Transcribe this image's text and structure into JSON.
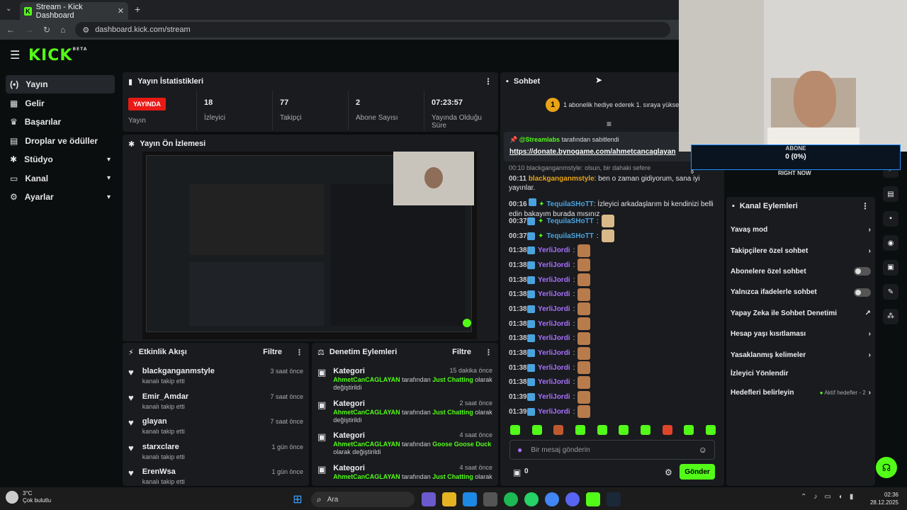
{
  "browser": {
    "tab_title": "Stream - Kick Dashboard",
    "url": "dashboard.kick.com/stream"
  },
  "logo": {
    "text": "KICK",
    "beta": "BETA"
  },
  "sidebar": {
    "items": [
      {
        "label": "Yayın",
        "icon": "broadcast-icon",
        "active": true
      },
      {
        "label": "Gelir",
        "icon": "revenue-icon"
      },
      {
        "label": "Başarılar",
        "icon": "trophy-icon"
      },
      {
        "label": "Droplar ve ödüller",
        "icon": "gift-icon"
      },
      {
        "label": "Stüdyo",
        "icon": "studio-icon",
        "expand": true
      },
      {
        "label": "Kanal",
        "icon": "channel-icon",
        "expand": true
      },
      {
        "label": "Ayarlar",
        "icon": "settings-icon",
        "expand": true
      }
    ]
  },
  "stats": {
    "title": "Yayın İstatistikleri",
    "live_badge": "YAYINDA",
    "live_label": "Yayın",
    "viewers": "18",
    "viewers_label": "İzleyici",
    "followers": "77",
    "followers_label": "Takipçi",
    "subs": "2",
    "subs_label": "Abone Sayısı",
    "uptime": "07:23:57",
    "uptime_label": "Yayında Olduğu Süre"
  },
  "preview": {
    "title": "Yayın Ön İzlemesi"
  },
  "activity": {
    "title": "Etkinlik Akışı",
    "filter": "Filtre",
    "items": [
      {
        "name": "blackganganmstyle",
        "sub": "kanalı takip etti",
        "time": "3 saat önce"
      },
      {
        "name": "Emir_Amdar",
        "sub": "kanalı takip etti",
        "time": "7 saat önce"
      },
      {
        "name": "glayan",
        "sub": "kanalı takip etti",
        "time": "7 saat önce"
      },
      {
        "name": "starxclare",
        "sub": "kanalı takip etti",
        "time": "1 gün önce"
      },
      {
        "name": "ErenWsa",
        "sub": "kanalı takip etti",
        "time": "1 gün önce"
      }
    ]
  },
  "modlog": {
    "title": "Denetim Eylemleri",
    "filter": "Filtre",
    "items": [
      {
        "name": "Kategori",
        "time": "15 dakika önce",
        "user": "AhmetCanCAGLAYAN",
        "mid": "tarafından",
        "cat": "Just Chatting",
        "end": "olarak",
        "end2": "değiştirildi"
      },
      {
        "name": "Kategori",
        "time": "2 saat önce",
        "user": "AhmetCanCAGLAYAN",
        "mid": "tarafından",
        "cat": "Just Chatting",
        "end": "olarak",
        "end2": "değiştirildi"
      },
      {
        "name": "Kategori",
        "time": "4 saat önce",
        "user": "AhmetCanCAGLAYAN",
        "mid": "tarafından",
        "cat": "Goose Goose Duck",
        "end": "",
        "end2": "olarak değiştirildi"
      },
      {
        "name": "Kategori",
        "time": "4 saat önce",
        "user": "AhmetCanCAGLAYAN",
        "mid": "tarafından",
        "cat": "Just Chatting",
        "end": "olarak",
        "end2": ""
      }
    ]
  },
  "chat": {
    "title": "Sohbet",
    "gift_rank": "1",
    "gift_text": "1 abonelik hediye ederek 1. sıraya yükselin",
    "pinned_by": "@Streamlabs",
    "pinned_suffix": "tarafından sabitlendi",
    "pinned_link": "https://donate.bynogame.com/ahmetcancaglayan",
    "partial_line": "00:10 blackganganmstyle: olsun, bir dahaki sefere",
    "messages": [
      {
        "t": "00:11",
        "user": "blackganganmstyle",
        "color": "#e8a317",
        "text": ": ben o zaman gidiyorum, sana iyi yayınlar."
      },
      {
        "t": "00:16",
        "user": "TequilaSHoTT",
        "color": "#4aa3df",
        "text": ": İzleyici arkadaşlarım bi kendinizi belli edin bakayım burada mısınız"
      },
      {
        "t": "00:37",
        "user": "TequilaSHoTT",
        "color": "#4aa3df",
        "text": ":"
      },
      {
        "t": "00:37",
        "user": "TequilaSHoTT",
        "color": "#4aa3df",
        "text": ":"
      },
      {
        "t": "01:38",
        "user": "YerliJordi",
        "color": "#a970ff",
        "text": ":"
      },
      {
        "t": "01:38",
        "user": "YerliJordi",
        "color": "#a970ff",
        "text": ":"
      },
      {
        "t": "01:38",
        "user": "YerliJordi",
        "color": "#a970ff",
        "text": ":"
      },
      {
        "t": "01:38",
        "user": "YerliJordi",
        "color": "#a970ff",
        "text": ":"
      },
      {
        "t": "01:38",
        "user": "YerliJordi",
        "color": "#a970ff",
        "text": ":"
      },
      {
        "t": "01:38",
        "user": "YerliJordi",
        "color": "#a970ff",
        "text": ":"
      },
      {
        "t": "01:38",
        "user": "YerliJordi",
        "color": "#a970ff",
        "text": ":"
      },
      {
        "t": "01:38",
        "user": "YerliJordi",
        "color": "#a970ff",
        "text": ":"
      },
      {
        "t": "01:38",
        "user": "YerliJordi",
        "color": "#a970ff",
        "text": ":"
      },
      {
        "t": "01:38",
        "user": "YerliJordi",
        "color": "#a970ff",
        "text": ":"
      },
      {
        "t": "01:39",
        "user": "YerliJordi",
        "color": "#a970ff",
        "text": ":"
      },
      {
        "t": "01:39",
        "user": "YerliJordi",
        "color": "#a970ff",
        "text": ":"
      }
    ],
    "input_placeholder": "Bir mesaj gönderin",
    "points": "0",
    "send": "Gönder"
  },
  "overlay": {
    "label": "ABONE",
    "value": "0 (0%)",
    "right_now": "RIGHT NOW",
    "zero": "0"
  },
  "channel_actions": {
    "title": "Kanal Eylemleri",
    "items": [
      {
        "label": "Yavaş mod",
        "right": "chevron"
      },
      {
        "label": "Takipçilere özel sohbet",
        "right": "chevron"
      },
      {
        "label": "Abonelere özel sohbet",
        "right": "toggle"
      },
      {
        "label": "Yalnızca ifadelerle sohbet",
        "right": "toggle"
      },
      {
        "label": "Yapay Zeka ile Sohbet Denetimi",
        "right": "external"
      },
      {
        "label": "Hesap yaşı kısıtlaması",
        "right": "chevron"
      },
      {
        "label": "Yasaklanmış kelimeler",
        "right": "chevron"
      },
      {
        "label": "İzleyici Yönlendir",
        "right": "none"
      },
      {
        "label": "Hedefleri belirleyin",
        "right": "chevron",
        "extra": "Aktif hedefler - 2"
      }
    ]
  },
  "taskbar": {
    "weather_temp": "3°C",
    "weather_desc": "Çok bulutlu",
    "search": "Ara",
    "time": "02:36",
    "date": "28.12.2025"
  },
  "colors": {
    "accent": "#53fc18",
    "live": "#e91916",
    "panel": "#191b1f"
  }
}
